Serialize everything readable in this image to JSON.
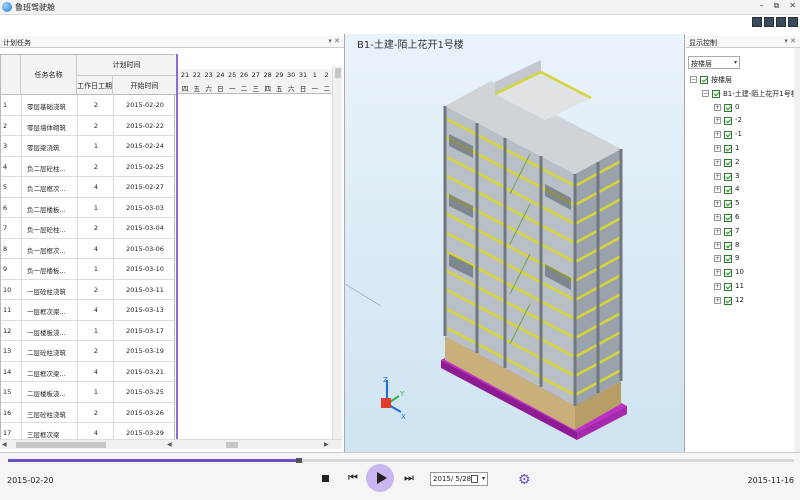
{
  "app": {
    "title": "鲁班驾驶舱"
  },
  "window": {
    "min": "–",
    "restore": "⧉",
    "close": "✕"
  },
  "left_panel": {
    "title": "计划任务",
    "controls": "▾ ✕",
    "columns": {
      "name": "任务名称",
      "plan_time": "计划时间",
      "workdays": "工作日工期",
      "start": "开始时间"
    },
    "days": [
      "21",
      "22",
      "23",
      "24",
      "25",
      "26",
      "27",
      "28",
      "29",
      "30",
      "31",
      "1",
      "2"
    ],
    "weekdays": [
      "四",
      "五",
      "六",
      "日",
      "一",
      "二",
      "三",
      "四",
      "五",
      "六",
      "日",
      "一",
      "二"
    ],
    "rows": [
      {
        "n": "1",
        "name": "零层基础浇筑",
        "dur": "2",
        "start": "2015-02-20"
      },
      {
        "n": "2",
        "name": "零层墙体砌筑",
        "dur": "2",
        "start": "2015-02-22"
      },
      {
        "n": "3",
        "name": "零层梁浇筑",
        "dur": "1",
        "start": "2015-02-24"
      },
      {
        "n": "4",
        "name": "负二层砼柱...",
        "dur": "2",
        "start": "2015-02-25"
      },
      {
        "n": "5",
        "name": "负二层框次...",
        "dur": "4",
        "start": "2015-02-27"
      },
      {
        "n": "6",
        "name": "负二层楼板...",
        "dur": "1",
        "start": "2015-03-03"
      },
      {
        "n": "7",
        "name": "负一层砼柱...",
        "dur": "2",
        "start": "2015-03-04"
      },
      {
        "n": "8",
        "name": "负一层框次...",
        "dur": "4",
        "start": "2015-03-06"
      },
      {
        "n": "9",
        "name": "负一层楼板...",
        "dur": "1",
        "start": "2015-03-10"
      },
      {
        "n": "10",
        "name": "一层砼柱浇筑",
        "dur": "2",
        "start": "2015-03-11"
      },
      {
        "n": "11",
        "name": "一层框次梁...",
        "dur": "4",
        "start": "2015-03-13"
      },
      {
        "n": "12",
        "name": "一层楼板浇...",
        "dur": "1",
        "start": "2015-03-17"
      },
      {
        "n": "13",
        "name": "二层砼柱浇筑",
        "dur": "2",
        "start": "2015-03-19"
      },
      {
        "n": "14",
        "name": "二层框次梁...",
        "dur": "4",
        "start": "2015-03-21"
      },
      {
        "n": "15",
        "name": "二层楼板浇...",
        "dur": "1",
        "start": "2015-03-25"
      },
      {
        "n": "16",
        "name": "三层砼柱浇筑",
        "dur": "2",
        "start": "2015-03-26"
      },
      {
        "n": "17",
        "name": "三层框次梁",
        "dur": "4",
        "start": "2015-03-29"
      }
    ]
  },
  "view": {
    "title": "B1-土建-陌上花开1号楼"
  },
  "right_panel": {
    "title": "显示控制",
    "controls": "▾ ✕",
    "select_value": "按楼层",
    "tree_root": "按楼层",
    "tree_project": "B1-土建-陌上花开1号楼",
    "floors": [
      "0",
      "-2",
      "-1",
      "1",
      "2",
      "3",
      "4",
      "5",
      "6",
      "7",
      "8",
      "9",
      "10",
      "11",
      "12"
    ]
  },
  "bottom": {
    "start_date": "2015-02-20",
    "end_date": "2015-11-16",
    "current_date": "2015/ 5/28",
    "progress": 0.37
  },
  "icons": {
    "stop": "stop-icon",
    "prev": "rewind-icon",
    "play": "play-icon",
    "next": "fast-forward-icon",
    "settings": "gear-icon",
    "calendar": "calendar-icon"
  },
  "colors": {
    "accent": "#6b4fc9",
    "beam_yellow": "#d6d43a",
    "base_magenta": "#c02cc8"
  }
}
